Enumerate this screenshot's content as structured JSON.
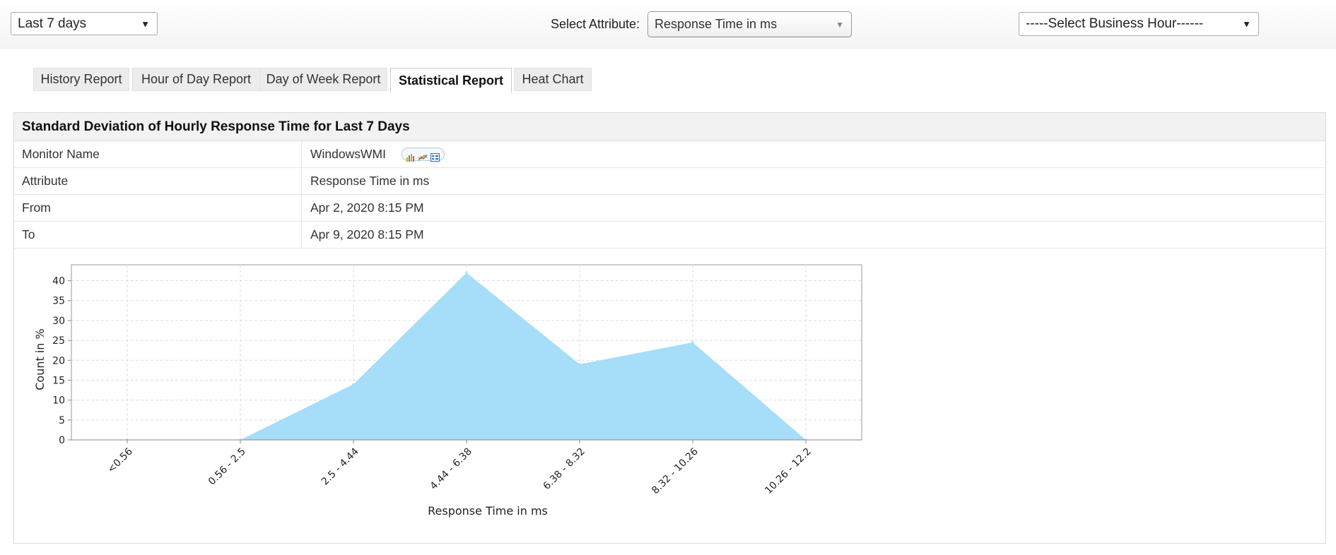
{
  "filters": {
    "range_value": "Last 7 days",
    "attribute_label": "Select Attribute:",
    "attribute_value": "Response Time in ms",
    "business_hour_value": "-----Select Business Hour------"
  },
  "tabs": [
    {
      "label": "History Report",
      "active": false
    },
    {
      "label": "Hour of Day Report",
      "active": false
    },
    {
      "label": "Day of Week Report",
      "active": false
    },
    {
      "label": "Statistical Report",
      "active": true
    },
    {
      "label": "Heat Chart",
      "active": false
    }
  ],
  "report": {
    "title": "Standard Deviation of Hourly Response Time for Last 7 Days",
    "rows": [
      {
        "key": "Monitor Name",
        "value": "WindowsWMI"
      },
      {
        "key": "Attribute",
        "value": "Response Time in ms"
      },
      {
        "key": "From",
        "value": "Apr 2, 2020 8:15 PM"
      },
      {
        "key": "To",
        "value": "Apr 9, 2020 8:15 PM"
      }
    ],
    "monitor_icons": [
      "bar-chart-icon",
      "line-chart-icon",
      "table-grid-icon"
    ]
  },
  "chart_data": {
    "type": "area",
    "categories": [
      "<0.56",
      "0.56 - 2.5",
      "2.5 - 4.44",
      "4.44 - 6.38",
      "6.38 - 8.32",
      "8.32 - 10.26",
      "10.26 - 12.2"
    ],
    "values": [
      0,
      0,
      14,
      42,
      19,
      24.5,
      0
    ],
    "xlabel": "Response Time in ms",
    "ylabel": "Count in %",
    "ylim": [
      0,
      44
    ],
    "yticks": [
      0,
      5,
      10,
      15,
      20,
      25,
      30,
      35,
      40
    ],
    "grid": true,
    "fill_color": "#a6ddf8"
  }
}
